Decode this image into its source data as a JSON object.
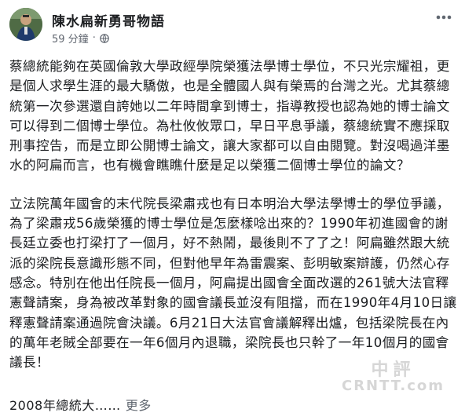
{
  "header": {
    "author_name": "陳水扁新勇哥物語",
    "timestamp": "59 分鐘",
    "separator": "·",
    "privacy_icon": "globe-icon",
    "more_icon": "ellipsis-icon"
  },
  "post": {
    "paragraphs": [
      "蔡總統能夠在英國倫敦大學政經學院榮獲法學博士學位，不只光宗耀祖，更是個人求學生涯的最大驕傲，也是全體國人與有榮焉的台灣之光。尤其蔡總統第一次參選還自誇她以二年時間拿到博士，指導教授也認為她的博士論文可以得到二個博士學位。為杜攸攸眾口，早日平息爭議，蔡總統實不應採取刑事控告，而是立即公開博士論文，讓大家都可以自由閱覽。對沒喝過洋墨水的阿扁而言，也有機會瞧瞧什麼是足以榮獲二個博士學位的論文？",
      "立法院萬年國會的末代院長梁肅戎也有日本明治大學法學博士的學位爭議，為了梁肅戎56歲榮獲的博士學位是怎麼樣唸出來的？1990年初進國會的謝長廷立委也打梁打了一個月，好不熱鬧，最後則不了了之！阿扁雖然跟大統派的梁院長意識形態不同，但對他早年為雷震案、彭明敏案辯護，仍然心存感念。特別在他出任院長一個月，阿扁提出國會全面改選的261號大法官釋憲聲請案，身為被改革對象的國會議長並沒有阻擋，而在1990年4月10日讓釋憲聲請案通過院會決議。6月21日大法官會議解釋出爐，包括梁院長在內的萬年老賊全部要在一年6個月內退職，梁院長也只幹了一年10個月的國會議長！"
    ],
    "truncated_text": "2008年總統大……",
    "see_more_label": "更多"
  },
  "watermark": {
    "line1": "中評",
    "line2": "CRNTT.com"
  },
  "colors": {
    "text": "#1c1e21",
    "meta": "#616770",
    "see_more": "#606770",
    "background": "#ffffff"
  }
}
